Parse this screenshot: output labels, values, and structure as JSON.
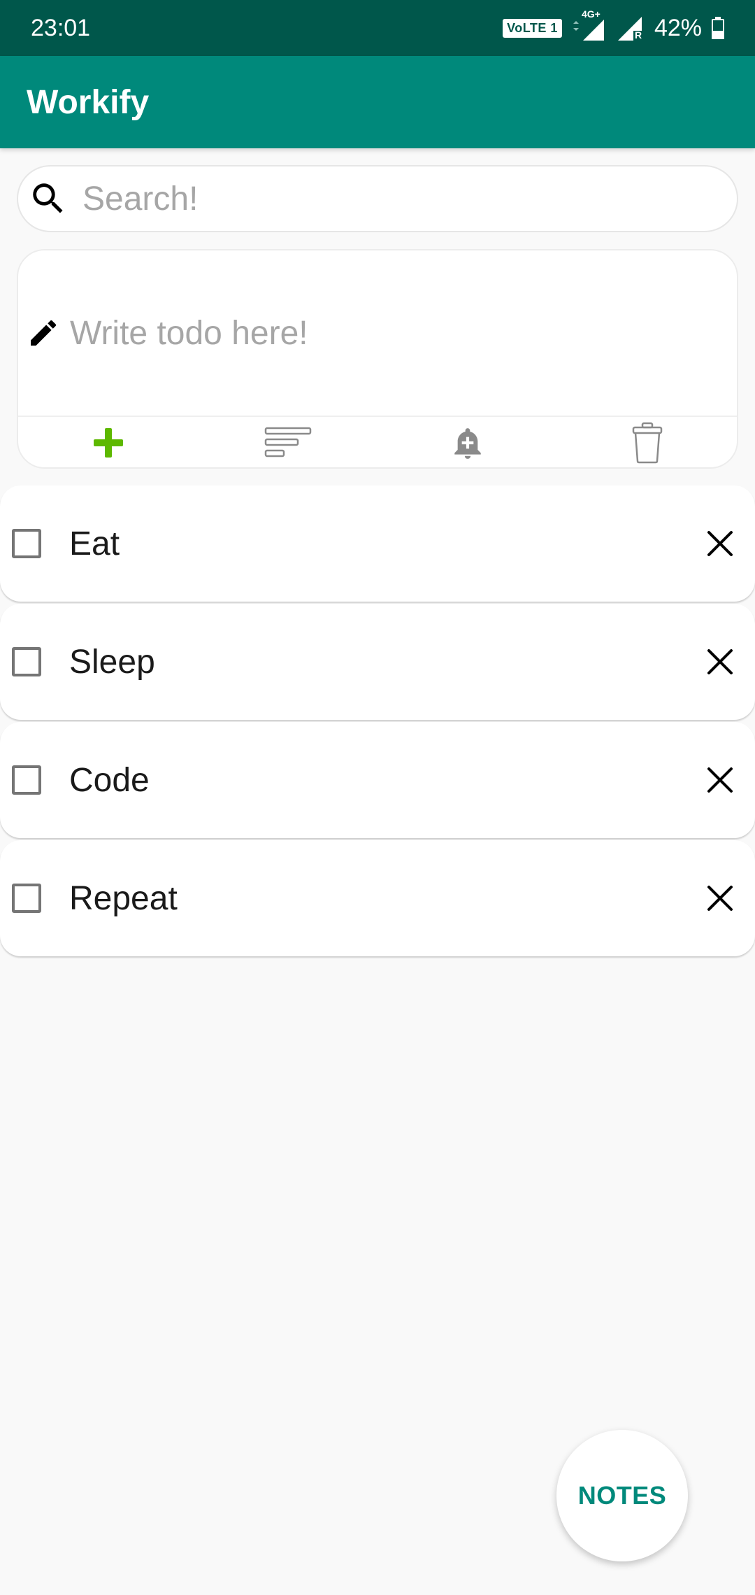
{
  "status_bar": {
    "time": "23:01",
    "volte_label": "VoLTE 1",
    "network_label": "4G+",
    "roaming_label": "R",
    "battery_percent": "42%",
    "battery_level": 0.42
  },
  "app_bar": {
    "title": "Workify"
  },
  "search": {
    "placeholder": "Search!",
    "value": ""
  },
  "composer": {
    "placeholder": "Write todo here!",
    "value": "",
    "tools": [
      {
        "icon": "plus-icon",
        "color": "#5db800"
      },
      {
        "icon": "sort-icon"
      },
      {
        "icon": "bell-plus-icon"
      },
      {
        "icon": "trash-icon"
      }
    ]
  },
  "todos": [
    {
      "label": "Eat",
      "checked": false
    },
    {
      "label": "Sleep",
      "checked": false
    },
    {
      "label": "Code",
      "checked": false
    },
    {
      "label": "Repeat",
      "checked": false
    }
  ],
  "fab": {
    "label": "NOTES"
  },
  "colors": {
    "status_bar": "#00574b",
    "app_bar": "#00897b",
    "accent": "#00897b",
    "add_green": "#5db800"
  }
}
